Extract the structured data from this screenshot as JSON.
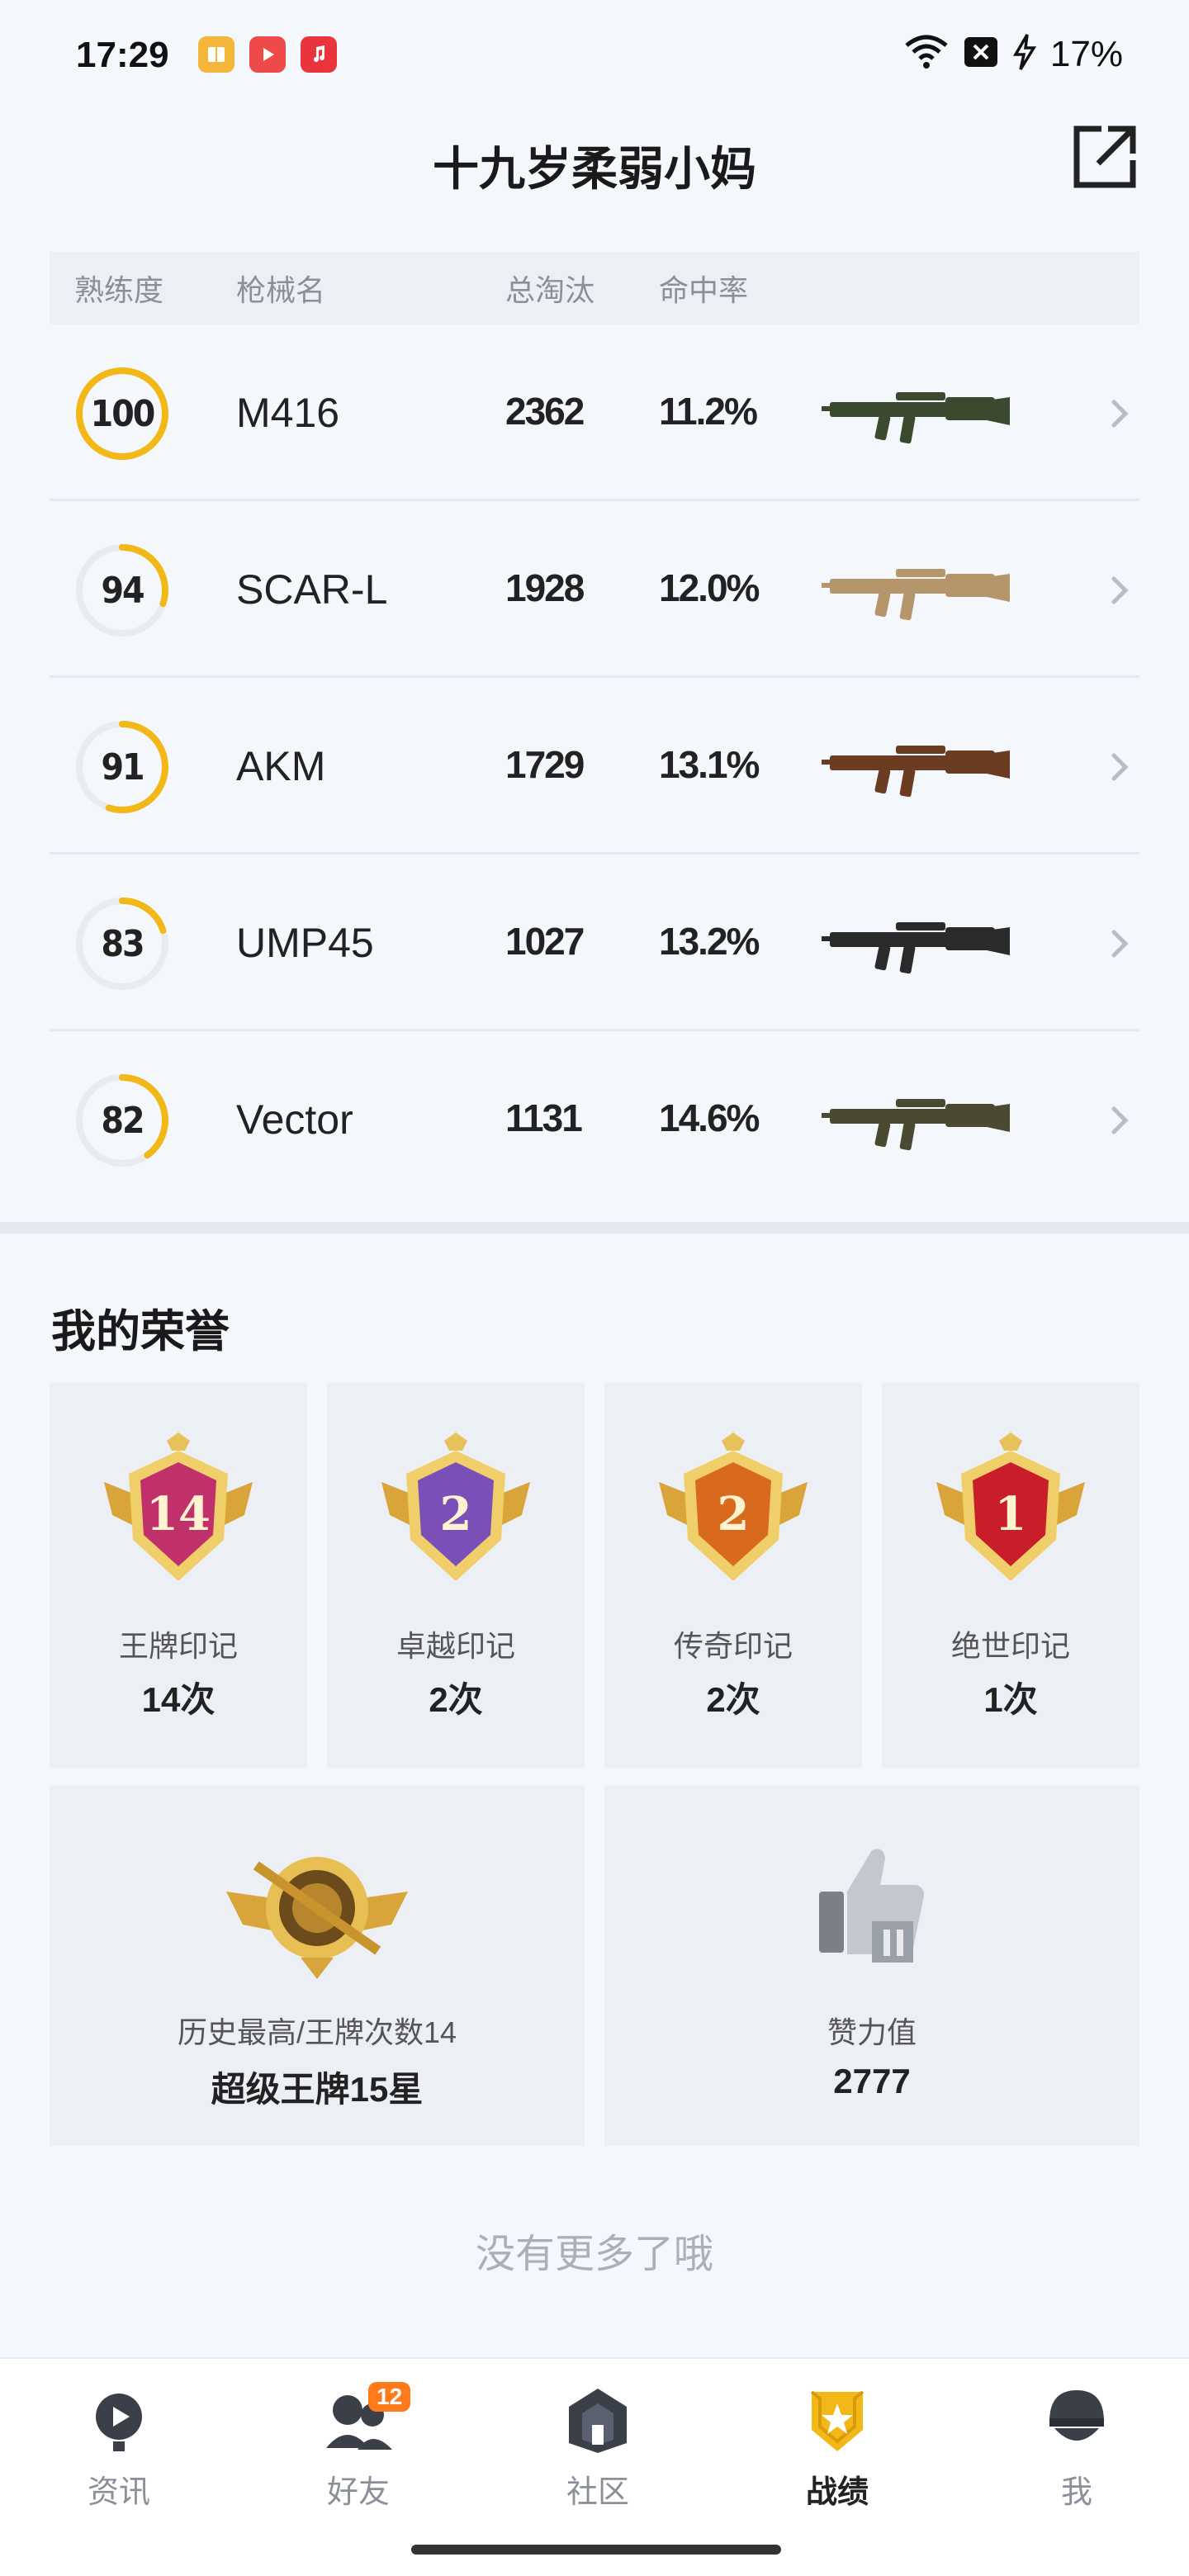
{
  "status_bar": {
    "time": "17:29",
    "battery": "17%",
    "app_icons": [
      "books-icon",
      "video-icon",
      "music-icon"
    ]
  },
  "header": {
    "title": "十九岁柔弱小妈"
  },
  "table": {
    "headers": [
      "熟练度",
      "枪械名",
      "总淘汰",
      "命中率"
    ],
    "rows": [
      {
        "proficiency": "100",
        "progress": 1.0,
        "name": "M416",
        "kills": "2362",
        "hit_rate": "11.2%",
        "gun_color": "#3b4a2e"
      },
      {
        "proficiency": "94",
        "progress": 0.3,
        "name": "SCAR-L",
        "kills": "1928",
        "hit_rate": "12.0%",
        "gun_color": "#b5966a"
      },
      {
        "proficiency": "91",
        "progress": 0.55,
        "name": "AKM",
        "kills": "1729",
        "hit_rate": "13.1%",
        "gun_color": "#6b3b22"
      },
      {
        "proficiency": "83",
        "progress": 0.2,
        "name": "UMP45",
        "kills": "1027",
        "hit_rate": "13.2%",
        "gun_color": "#2a2a2a"
      },
      {
        "proficiency": "82",
        "progress": 0.4,
        "name": "Vector",
        "kills": "1131",
        "hit_rate": "14.6%",
        "gun_color": "#4a4a32"
      }
    ]
  },
  "honors": {
    "title": "我的荣誉",
    "small": [
      {
        "medal_text": "14",
        "label": "王牌印记",
        "value": "14次",
        "color": "#c0306a"
      },
      {
        "medal_text": "2",
        "label": "卓越印记",
        "value": "2次",
        "color": "#7b4fb8"
      },
      {
        "medal_text": "2",
        "label": "传奇印记",
        "value": "2次",
        "color": "#d86a1e"
      },
      {
        "medal_text": "1",
        "label": "绝世印记",
        "value": "1次",
        "color": "#c81e2a"
      }
    ],
    "large": [
      {
        "label": "历史最高/王牌次数14",
        "value": "超级王牌15星",
        "icon": "ace-rank-icon"
      },
      {
        "label": "赞力值",
        "value": "2777",
        "icon": "thumbs-up-icon"
      }
    ]
  },
  "no_more": "没有更多了哦",
  "bottom_nav": {
    "items": [
      {
        "label": "资讯",
        "icon": "news-icon",
        "active": false
      },
      {
        "label": "好友",
        "icon": "friends-icon",
        "active": false,
        "badge": "12"
      },
      {
        "label": "社区",
        "icon": "community-icon",
        "active": false
      },
      {
        "label": "战绩",
        "icon": "record-icon",
        "active": true
      },
      {
        "label": "我",
        "icon": "profile-icon",
        "active": false
      }
    ]
  },
  "colors": {
    "accent": "#f2b818",
    "badge": "#ff7a1a",
    "background": "#f4f7fb"
  }
}
